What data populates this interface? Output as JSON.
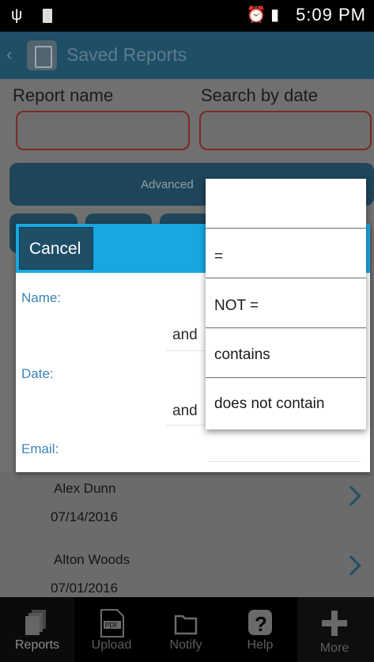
{
  "status_bar": {
    "time": "5:09 PM",
    "battery_level": "100",
    "icons": [
      "usb-icon",
      "battery-icon",
      "alarm-icon",
      "wifi-icon",
      "signal-icon"
    ]
  },
  "app_bar": {
    "title": "Saved Reports"
  },
  "filters": {
    "report_name_label": "Report name",
    "search_by_date_label": "Search by date",
    "advanced_label": "Advanced"
  },
  "reports": [
    {
      "name": "Alex Dunn",
      "date": "07/14/2016"
    },
    {
      "name": "Alton Woods",
      "date": "07/01/2016"
    }
  ],
  "bottom_nav": [
    {
      "label": "Reports",
      "icon": "reports-icon"
    },
    {
      "label": "Upload",
      "icon": "pdf-upload-icon"
    },
    {
      "label": "Notify",
      "icon": "folder-icon"
    },
    {
      "label": "Help",
      "icon": "help-icon"
    },
    {
      "label": "More",
      "icon": "plus-icon"
    }
  ],
  "dialog": {
    "cancel_label": "Cancel",
    "name_label": "Name:",
    "and_label_1": "and",
    "date_label": "Date:",
    "and_label_2": "and",
    "email_label": "Email:"
  },
  "dropdown": {
    "options": [
      "",
      "=",
      "NOT =",
      "contains",
      "does not contain"
    ]
  },
  "colors": {
    "app_bar": "#1e4f67",
    "dialog_header": "#18a7e2",
    "label_blue": "#3b83b4",
    "input_border": "#7a2a24"
  }
}
